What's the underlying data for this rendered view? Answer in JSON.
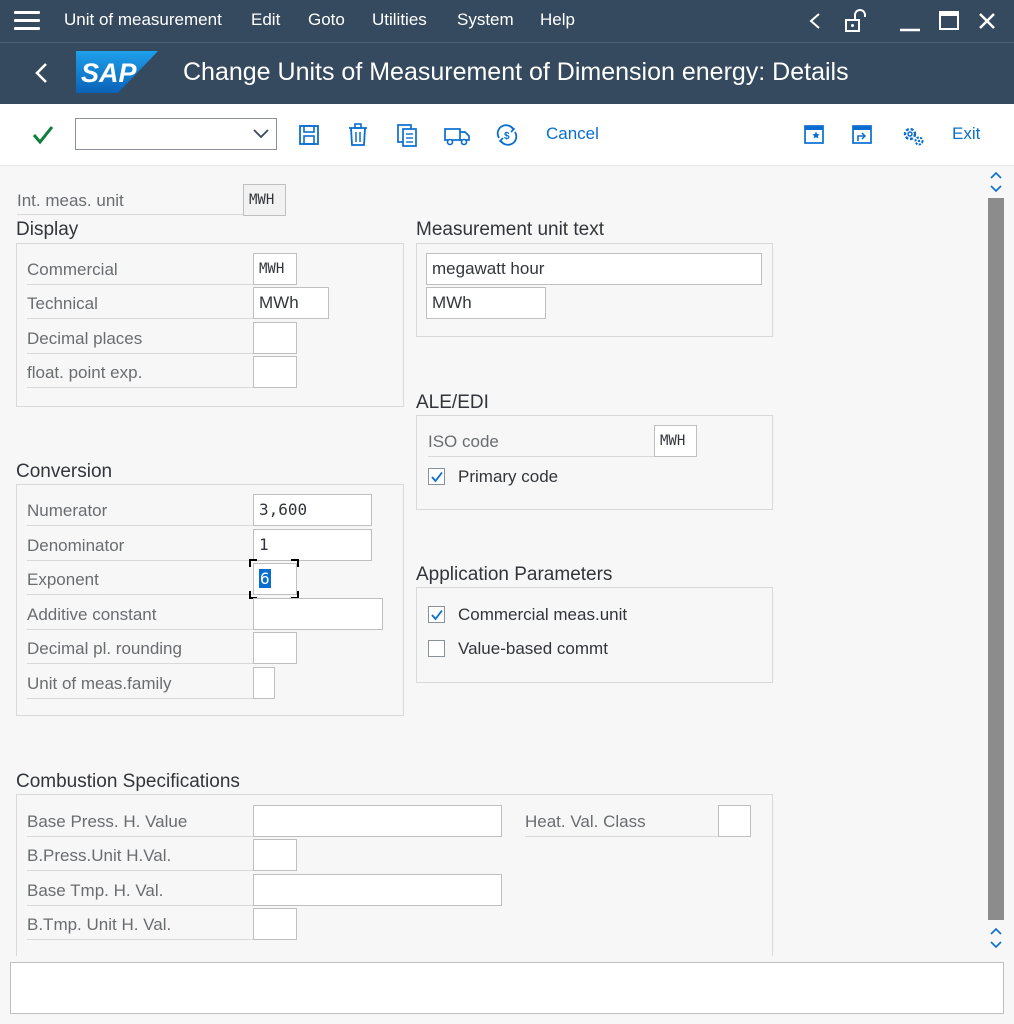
{
  "menu": {
    "items": [
      "Unit of measurement",
      "Edit",
      "Goto",
      "Utilities",
      "System",
      "Help"
    ]
  },
  "header": {
    "title": "Change Units of Measurement of Dimension energy: Details",
    "logo_text": "SAP"
  },
  "toolbar": {
    "command_field": "",
    "cancel": "Cancel",
    "exit": "Exit"
  },
  "header_fields": {
    "int_meas_unit_label": "Int. meas. unit",
    "int_meas_unit_value": "MWH"
  },
  "display": {
    "title": "Display",
    "commercial_label": "Commercial",
    "commercial_value": "MWH",
    "technical_label": "Technical",
    "technical_value": "MWh",
    "decimal_places_label": "Decimal places",
    "decimal_places_value": "",
    "float_point_label": "float. point exp.",
    "float_point_value": ""
  },
  "measurement_text": {
    "title": "Measurement unit text",
    "long_text": "megawatt hour",
    "short_text": "MWh"
  },
  "ale_edi": {
    "title": "ALE/EDI",
    "iso_code_label": "ISO code",
    "iso_code_value": "MWH",
    "primary_code_label": "Primary code",
    "primary_code_checked": true
  },
  "conversion": {
    "title": "Conversion",
    "numerator_label": "Numerator",
    "numerator_value": "3,600",
    "denominator_label": "Denominator",
    "denominator_value": "1",
    "exponent_label": "Exponent",
    "exponent_value": "6",
    "additive_label": "Additive constant",
    "additive_value": "",
    "rounding_label": "Decimal pl. rounding",
    "rounding_value": "",
    "family_label": "Unit of meas.family",
    "family_value": ""
  },
  "app_params": {
    "title": "Application Parameters",
    "commercial_meas_label": "Commercial meas.unit",
    "commercial_meas_checked": true,
    "value_based_label": "Value-based commt",
    "value_based_checked": false
  },
  "combustion": {
    "title": "Combustion Specifications",
    "base_press_label": "Base Press. H. Value",
    "base_press_value": "",
    "heat_val_class_label": "Heat. Val. Class",
    "heat_val_class_value": "",
    "press_unit_label": "B.Press.Unit H.Val.",
    "press_unit_value": "",
    "base_tmp_label": "Base Tmp. H. Val.",
    "base_tmp_value": "",
    "tmp_unit_label": "B.Tmp. Unit H. Val.",
    "tmp_unit_value": ""
  },
  "colors": {
    "shell": "#354a5f",
    "accent": "#0a6ed1",
    "confirm": "#107e3e"
  }
}
